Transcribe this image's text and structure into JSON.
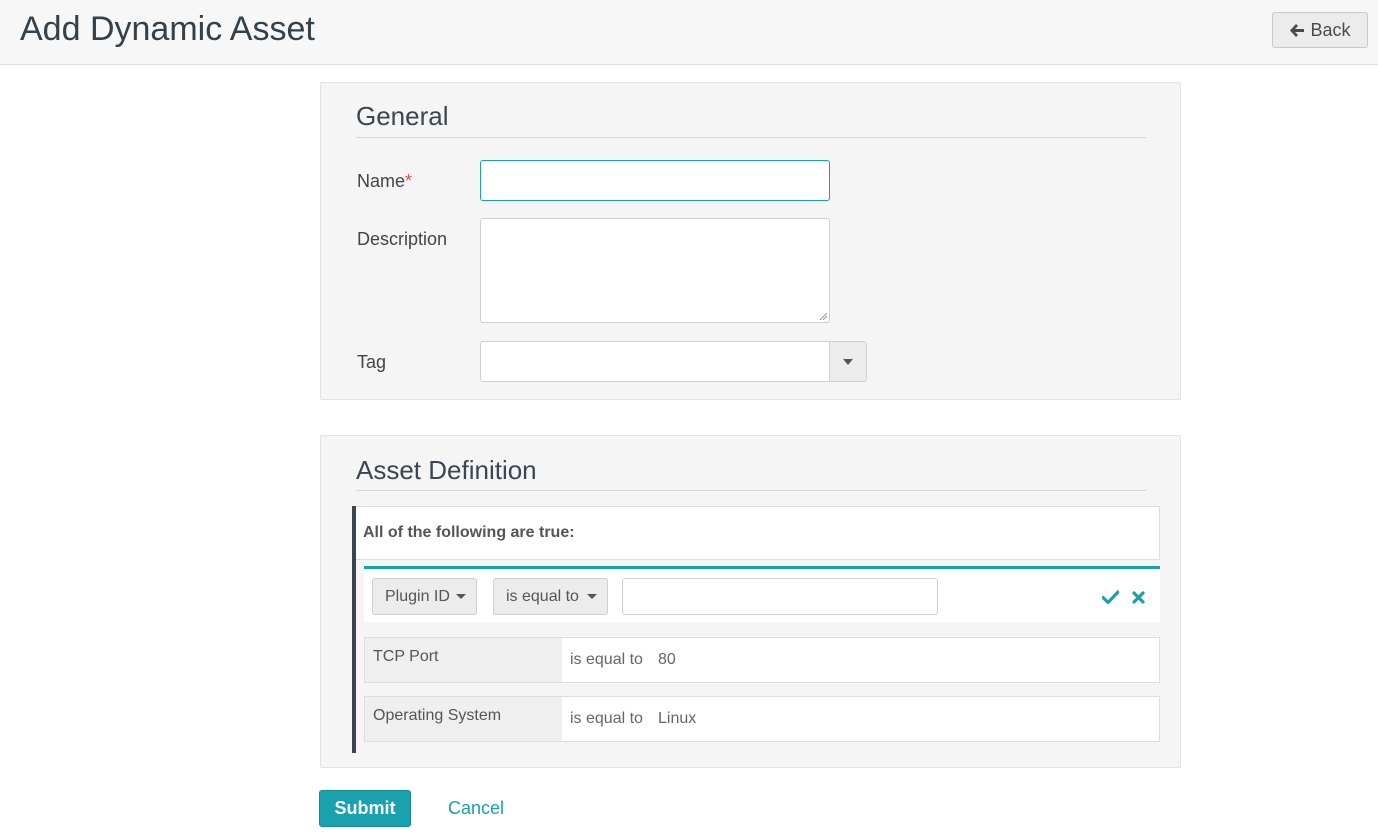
{
  "header": {
    "title": "Add Dynamic Asset",
    "back_label": "Back",
    "back_icon": "arrow-left-icon"
  },
  "general": {
    "title": "General",
    "name_label": "Name",
    "name_required_mark": "*",
    "name_value": "",
    "description_label": "Description",
    "description_value": "",
    "tag_label": "Tag",
    "tag_value": ""
  },
  "asset_definition": {
    "title": "Asset Definition",
    "group_label": "All of the following are true:",
    "editing_rule": {
      "field": "Plugin ID",
      "operator": "is equal to",
      "value": ""
    },
    "rules": [
      {
        "field": "TCP Port",
        "operator": "is equal to",
        "value": "80"
      },
      {
        "field": "Operating System",
        "operator": "is equal to",
        "value": "Linux"
      }
    ]
  },
  "actions": {
    "submit_label": "Submit",
    "cancel_label": "Cancel"
  },
  "colors": {
    "accent": "#1aa1ae",
    "required": "#d9534f",
    "group_border": "#3b4550"
  }
}
